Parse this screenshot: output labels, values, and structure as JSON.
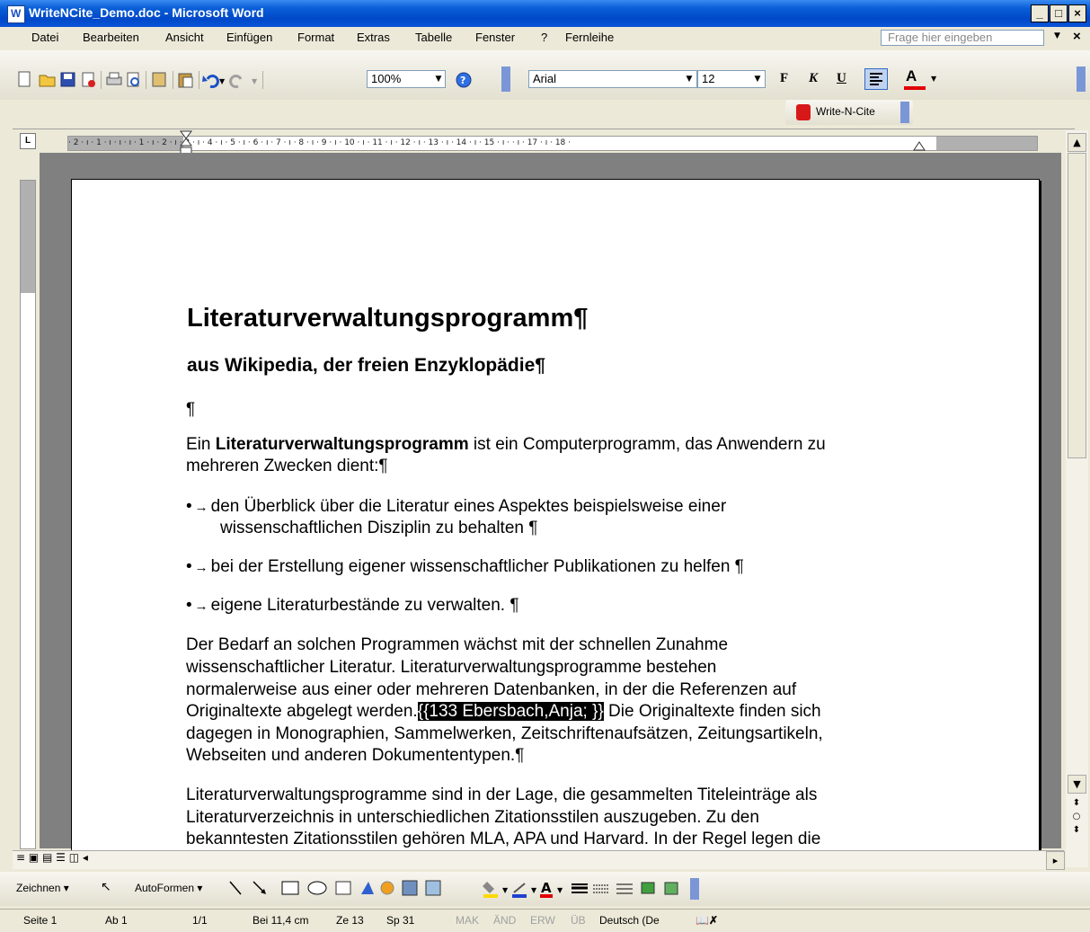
{
  "window": {
    "title": "WriteNCite_Demo.doc - Microsoft Word",
    "min": "_",
    "max": "□",
    "close": "×"
  },
  "menubar": {
    "items": [
      "Datei",
      "Bearbeiten",
      "Ansicht",
      "Einfügen",
      "Format",
      "Extras",
      "Tabelle",
      "Fenster",
      "?",
      "Fernleihe"
    ],
    "help_placeholder": "Frage hier eingeben",
    "close": "×"
  },
  "toolbar": {
    "zoom": "100%",
    "font": "Arial",
    "size": "12",
    "bold": "F",
    "italic": "K",
    "underline": "U",
    "fontcolor": "A",
    "writencite": "Write-N-Cite"
  },
  "ruler": {
    "ticks": "· 2 · ı · 1 · ı ·   ı · ı · 1 · ı · 2 · ı · 3 · ı · 4 · ı · 5 · ı · 6 · ı · 7 · ı · 8 · ı · 9 · ı · 10 · ı · 11 · ı · 12 · ı · 13 · ı · 14 · ı · 15 · ı ·   · ı · 17 · ı · 18 ·"
  },
  "document": {
    "heading": "Literaturverwaltungsprogramm¶",
    "subheading": "aus Wikipedia, der freien Enzyklopädie¶",
    "empty_para": "¶",
    "para1_pre": "Ein ",
    "para1_bold": "Literaturverwaltungsprogramm",
    "para1_post": " ist ein Computerprogramm, das Anwendern zu",
    "para1_line2": "mehreren Zwecken dient:¶",
    "bullet1_line1": "den Überblick über die Literatur eines Aspektes beispielsweise einer",
    "bullet1_line2": "wissenschaftlichen Disziplin zu behalten ¶",
    "bullet2": "bei der Erstellung eigener wissenschaftlicher Publikationen zu helfen ¶",
    "bullet3": "eigene Literaturbestände zu verwalten. ¶",
    "bullet_marker": "•",
    "bullet_arrow": "→",
    "para2_line1": "Der Bedarf an solchen Programmen wächst mit der schnellen Zunahme",
    "para2_line2": "wissenschaftlicher Literatur. Literaturverwaltungsprogramme bestehen",
    "para2_line3": "normalerweise aus einer oder mehreren Datenbanken, in der die Referenzen auf",
    "para2_line4_pre": "Originaltexte abgelegt werden.",
    "para2_citation": "{{133 Ebersbach,Anja; }}",
    "para2_line4_post": " Die Originaltexte finden sich",
    "para2_line5": "dagegen in Monographien, Sammelwerken, Zeitschriftenaufsätzen, Zeitungsartikeln,",
    "para2_line6": "Webseiten und anderen Dokumententypen.¶",
    "para3_line1": "Literaturverwaltungsprogramme sind in der Lage, die gesammelten Titeleinträge als",
    "para3_line2": "Literaturverzeichnis in unterschiedlichen Zitationsstilen auszugeben. Zu den",
    "para3_line3": "bekanntesten Zitationsstilen gehören MLA, APA und Harvard. In der Regel legen die"
  },
  "drawbar": {
    "draw": "Zeichnen ▾",
    "autoshapes": "AutoFormen ▾"
  },
  "statusbar": {
    "page": "Seite 1",
    "section": "Ab 1",
    "pages": "1/1",
    "position": "Bei 11,4 cm",
    "line": "Ze 13",
    "col": "Sp 31",
    "mak": "MAK",
    "aend": "ÄND",
    "erw": "ERW",
    "ueb": "ÜB",
    "lang": "Deutsch (De"
  },
  "colors": {
    "title_blue": "#0048c8",
    "font_color_red": "#e00000",
    "writencite_red": "#d81818"
  }
}
